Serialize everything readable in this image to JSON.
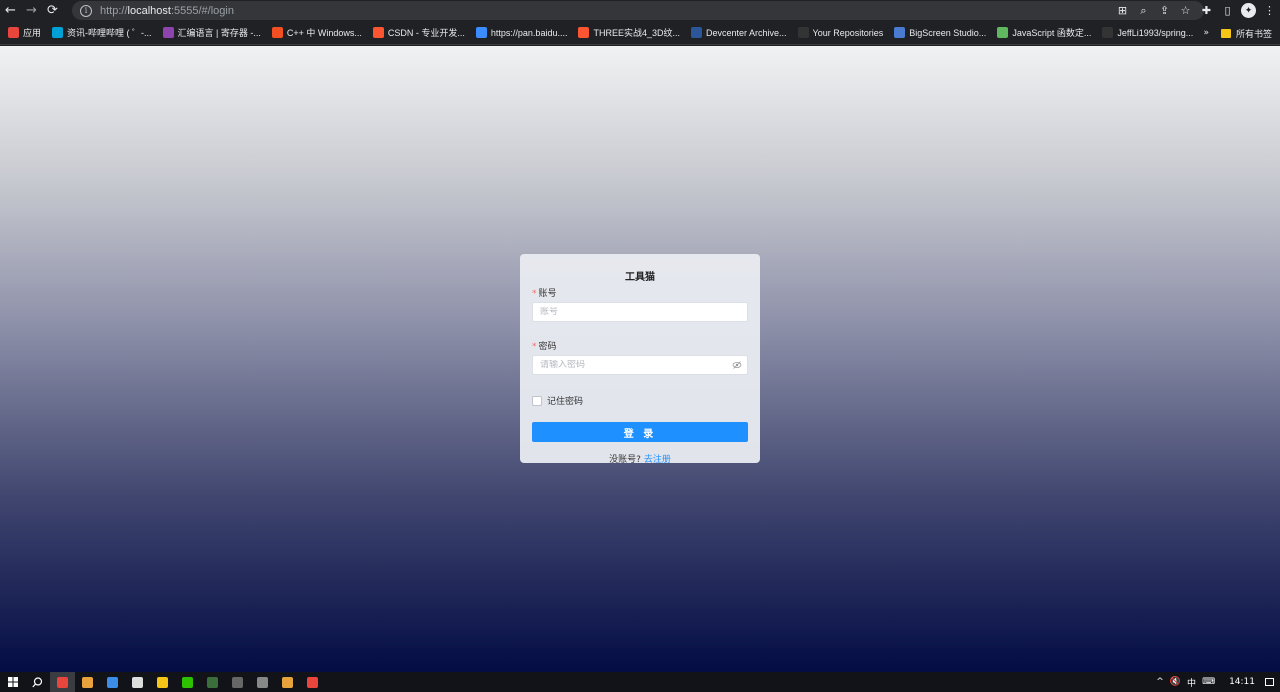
{
  "browser": {
    "url_prefix": "http://",
    "url_host": "localhost",
    "url_rest": ":5555/#/login",
    "nav": {
      "back": "←",
      "forward": "→",
      "reload": "⟳"
    },
    "icons": [
      "translate-icon",
      "zoom-icon",
      "share-icon",
      "star-icon",
      "extensions-icon",
      "sidebar-icon",
      "profile-icon",
      "menu-icon"
    ]
  },
  "bookmarks": {
    "items": [
      {
        "label": "应用",
        "color": "#e8453c"
      },
      {
        "label": "资讯-哔哩哔哩 ( ゜-...",
        "color": "#00a1d6"
      },
      {
        "label": "汇编语言 | 寄存器 -...",
        "color": "#8e44ad"
      },
      {
        "label": "C++ 中 Windows...",
        "color": "#f25022"
      },
      {
        "label": "CSDN - 专业开发...",
        "color": "#fc5531"
      },
      {
        "label": "https://pan.baidu....",
        "color": "#3b8cff"
      },
      {
        "label": "THREE实战4_3D纹...",
        "color": "#fc5531"
      },
      {
        "label": "Devcenter Archive...",
        "color": "#2b579a"
      },
      {
        "label": "Your Repositories",
        "color": "#333333"
      },
      {
        "label": "BigScreen Studio...",
        "color": "#4a7bd1"
      },
      {
        "label": "JavaScript 函数定...",
        "color": "#5fb85f"
      },
      {
        "label": "JeffLi1993/spring...",
        "color": "#333333"
      }
    ],
    "more": "»",
    "all_bookmarks": "所有书签"
  },
  "login": {
    "title": "工具猫",
    "required_mark": "*",
    "account_label": "账号",
    "account_placeholder": "账号",
    "password_label": "密码",
    "password_placeholder": "请输入密码",
    "remember_label": "记住密码",
    "login_button": "登 录",
    "no_account_text": "没账号?",
    "register_link": "去注册"
  },
  "taskbar": {
    "apps": [
      {
        "name": "chrome",
        "color": "#e8453c",
        "active": true
      },
      {
        "name": "app2",
        "color": "#e8a33c"
      },
      {
        "name": "app3",
        "color": "#3c8de8"
      },
      {
        "name": "qq",
        "color": "#dddddd"
      },
      {
        "name": "explorer",
        "color": "#f5c518"
      },
      {
        "name": "wechat",
        "color": "#2dc100"
      },
      {
        "name": "app7",
        "color": "#3b6e3b"
      },
      {
        "name": "terminal",
        "color": "#666666"
      },
      {
        "name": "app9",
        "color": "#888888"
      },
      {
        "name": "app10",
        "color": "#e8a33c"
      },
      {
        "name": "app11",
        "color": "#e8453c"
      }
    ],
    "tray": {
      "chevron": "^",
      "volume": "🔇",
      "ime": "中",
      "keyboard": "⌨",
      "clock": "14:11"
    }
  }
}
